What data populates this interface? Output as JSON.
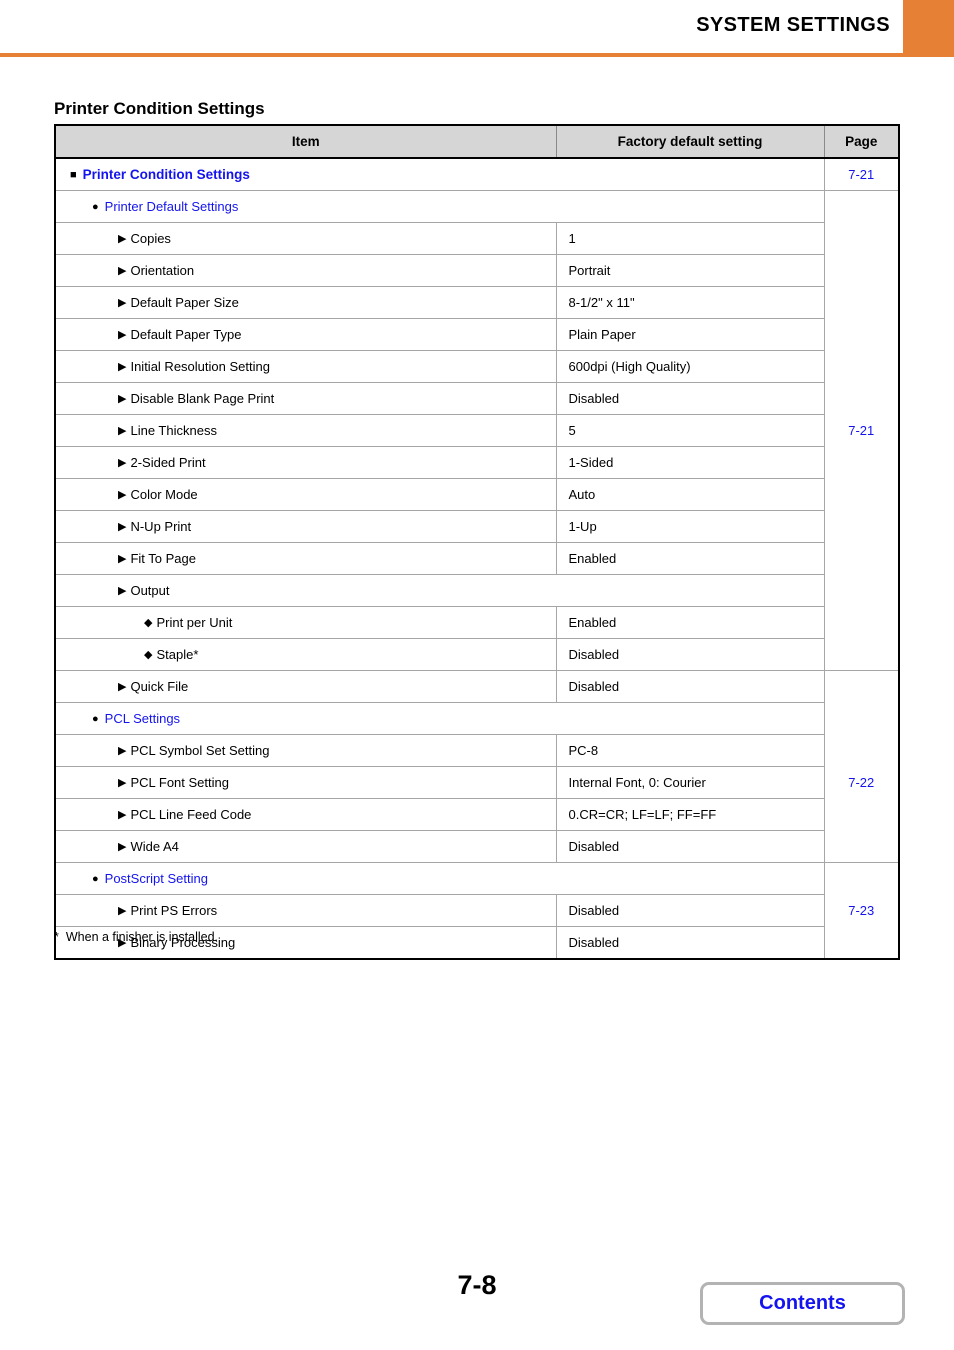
{
  "header": {
    "title": "SYSTEM SETTINGS",
    "accent_color": "#e58034"
  },
  "section_heading": "Printer Condition Settings",
  "table": {
    "columns": [
      "Item",
      "Factory default setting",
      "Page"
    ],
    "link_color": "#1414ef",
    "header_bg": "#d6d6d6",
    "rows": [
      {
        "level": 1,
        "marker": "square-bullet",
        "label": "Printer Condition Settings",
        "value": null,
        "span": true,
        "page": "7-21",
        "page_rowspan": 1
      },
      {
        "level": 2,
        "marker": "circle-bullet",
        "label": "Printer Default Settings",
        "value": null,
        "span": true,
        "page": "7-21",
        "page_rowspan": 15
      },
      {
        "level": 3,
        "marker": "triangle-bullet",
        "label": "Copies",
        "value": "1",
        "span": false
      },
      {
        "level": 3,
        "marker": "triangle-bullet",
        "label": "Orientation",
        "value": "Portrait",
        "span": false
      },
      {
        "level": 3,
        "marker": "triangle-bullet",
        "label": "Default Paper Size",
        "value": "8-1/2\" x 11\"",
        "span": false
      },
      {
        "level": 3,
        "marker": "triangle-bullet",
        "label": "Default Paper Type",
        "value": "Plain Paper",
        "span": false
      },
      {
        "level": 3,
        "marker": "triangle-bullet",
        "label": "Initial Resolution Setting",
        "value": "600dpi (High Quality)",
        "span": false
      },
      {
        "level": 3,
        "marker": "triangle-bullet",
        "label": "Disable Blank Page Print",
        "value": "Disabled",
        "span": false
      },
      {
        "level": 3,
        "marker": "triangle-bullet",
        "label": "Line Thickness",
        "value": "5",
        "span": false
      },
      {
        "level": 3,
        "marker": "triangle-bullet",
        "label": "2-Sided Print",
        "value": "1-Sided",
        "span": false
      },
      {
        "level": 3,
        "marker": "triangle-bullet",
        "label": "Color Mode",
        "value": "Auto",
        "span": false
      },
      {
        "level": 3,
        "marker": "triangle-bullet",
        "label": "N-Up Print",
        "value": "1-Up",
        "span": false
      },
      {
        "level": 3,
        "marker": "triangle-bullet",
        "label": "Fit To Page",
        "value": "Enabled",
        "span": false
      },
      {
        "level": 3,
        "marker": "triangle-bullet",
        "label": "Output",
        "value": null,
        "span": true
      },
      {
        "level": 4,
        "marker": "diamond-bullet",
        "label": "Print per Unit",
        "value": "Enabled",
        "span": false
      },
      {
        "level": 4,
        "marker": "diamond-bullet",
        "label": "Staple*",
        "value": "Disabled",
        "span": false
      },
      {
        "level": 3,
        "marker": "triangle-bullet",
        "label": "Quick File",
        "value": "Disabled",
        "span": false
      },
      {
        "level": 2,
        "marker": "circle-bullet",
        "label": "PCL Settings",
        "value": null,
        "span": true,
        "page": "7-22",
        "page_rowspan": 5
      },
      {
        "level": 3,
        "marker": "triangle-bullet",
        "label": "PCL Symbol Set Setting",
        "value": "PC-8",
        "span": false
      },
      {
        "level": 3,
        "marker": "triangle-bullet",
        "label": "PCL Font Setting",
        "value": "Internal Font, 0: Courier",
        "span": false
      },
      {
        "level": 3,
        "marker": "triangle-bullet",
        "label": "PCL Line Feed Code",
        "value": "0.CR=CR; LF=LF; FF=FF",
        "span": false
      },
      {
        "level": 3,
        "marker": "triangle-bullet",
        "label": "Wide A4",
        "value": "Disabled",
        "span": false
      },
      {
        "level": 2,
        "marker": "circle-bullet",
        "label": "PostScript Setting",
        "value": null,
        "span": true,
        "page": "7-23",
        "page_rowspan": 3
      },
      {
        "level": 3,
        "marker": "triangle-bullet",
        "label": "Print PS Errors",
        "value": "Disabled",
        "span": false
      },
      {
        "level": 3,
        "marker": "triangle-bullet",
        "label": "Binary Processing",
        "value": "Disabled",
        "span": false
      }
    ]
  },
  "footnote": {
    "mark": "*",
    "text": "When a finisher is installed."
  },
  "footer": {
    "page_number": "7-8",
    "contents_label": "Contents"
  }
}
